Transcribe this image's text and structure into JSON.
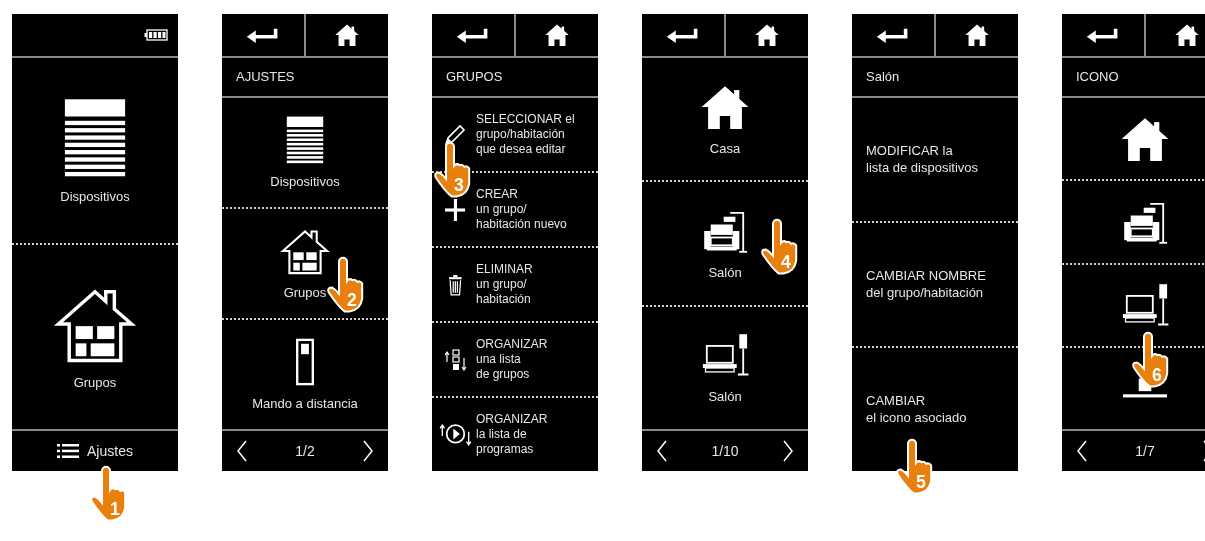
{
  "screens": [
    {
      "kind": "home",
      "tiles": [
        {
          "kind": "blinds",
          "label": "Dispositivos"
        },
        {
          "kind": "group",
          "label": "Grupos"
        }
      ],
      "footer": {
        "label": "Ajustes"
      },
      "hand": "1"
    },
    {
      "kind": "menu",
      "title": "AJUSTES",
      "tiles": [
        {
          "kind": "blinds",
          "label": "Dispositivos"
        },
        {
          "kind": "group",
          "label": "Grupos"
        },
        {
          "kind": "remote",
          "label": "Mando a distancia"
        }
      ],
      "pager": "1/2",
      "hand": "2"
    },
    {
      "kind": "list",
      "title": "GRUPOS",
      "rows": [
        {
          "kind": "pencil",
          "text": "SELECCIONAR el\ngrupo/habitación\nque desea editar"
        },
        {
          "kind": "plus",
          "text": "CREAR\nun grupo/\nhabitación nuevo"
        },
        {
          "kind": "trash",
          "text": "ELIMINAR\nun grupo/\nhabitación"
        },
        {
          "kind": "sort",
          "text": "ORGANIZAR\nuna lista\nde grupos"
        },
        {
          "kind": "playsort",
          "text": "ORGANIZAR\nla lista de\nprogramas"
        }
      ],
      "hand": "3"
    },
    {
      "kind": "menu",
      "tiles": [
        {
          "kind": "house",
          "label": "Casa"
        },
        {
          "kind": "armchair",
          "label": "Salón"
        },
        {
          "kind": "tv",
          "label": "Salón"
        }
      ],
      "pager": "1/10",
      "hand": "4"
    },
    {
      "kind": "options",
      "title": "Salón",
      "options": [
        "MODIFICAR la\nlista de dispositivos",
        "CAMBIAR NOMBRE\ndel grupo/habitación",
        "CAMBIAR\nel icono asociado"
      ],
      "hand": "5"
    },
    {
      "kind": "menu",
      "title": "ICONO",
      "tiles": [
        {
          "kind": "house"
        },
        {
          "kind": "armchair"
        },
        {
          "kind": "tv"
        },
        {
          "kind": "stand"
        }
      ],
      "pager": "1/7",
      "hand": "6"
    }
  ]
}
